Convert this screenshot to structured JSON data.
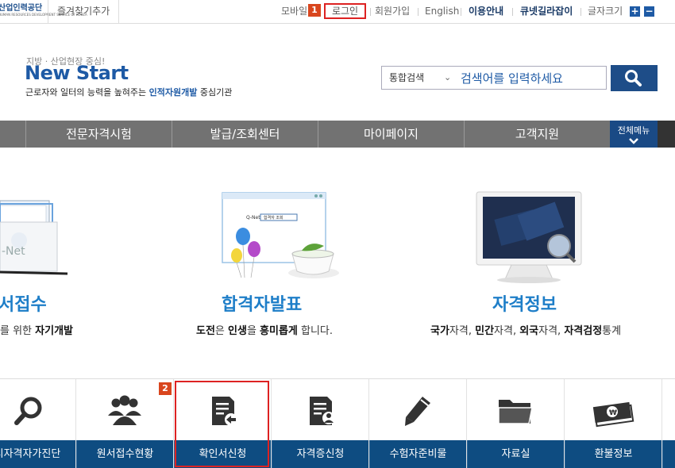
{
  "topbar": {
    "org_logo": "산업인력공단",
    "favorite": "즐겨찾기추가",
    "mobile": "모바일",
    "badge1": "1",
    "login": "로그인",
    "signup": "회원가입",
    "english": "English",
    "guide": "이용안내",
    "qnet_guide": "큐넷길라잡이",
    "font_size": "글자크기",
    "plus": "+",
    "minus": "−"
  },
  "header": {
    "tagline": "지방 · 산업현장 중심!",
    "brand": "New Start",
    "desc_pre": "근로자와 일터의 능력을 높혀주는 ",
    "desc_em": "인적자원개발",
    "desc_post": " 중심기관"
  },
  "search": {
    "category": "통합검색",
    "placeholder": "검색어를 입력하세요"
  },
  "nav": {
    "items": [
      "전문자격시험",
      "발급/조회센터",
      "마이페이지",
      "고객지원"
    ],
    "all_menu": "전체메뉴"
  },
  "features": [
    {
      "title": "서접수",
      "sub_pre": "를 위한 ",
      "sub_b": "자기개발",
      "sub_post": ""
    },
    {
      "title": "합격자발표"
    },
    {
      "title": "자격정보"
    }
  ],
  "feature2_sub": [
    {
      "t": "도전",
      "b": true
    },
    {
      "t": "은 ",
      "b": false
    },
    {
      "t": "인생",
      "b": true
    },
    {
      "t": "을 ",
      "b": false
    },
    {
      "t": "흥미롭게",
      "b": true
    },
    {
      "t": " 합니다.",
      "b": false
    }
  ],
  "feature3_sub": [
    {
      "t": "국가",
      "b": true
    },
    {
      "t": "자격, ",
      "b": false
    },
    {
      "t": "민간",
      "b": true
    },
    {
      "t": "자격, ",
      "b": false
    },
    {
      "t": "외국",
      "b": true
    },
    {
      "t": "자격, ",
      "b": false
    },
    {
      "t": "자격검정",
      "b": true
    },
    {
      "t": "통계",
      "b": false
    }
  ],
  "qnet_mock": {
    "brand": "Q-Net",
    "search_text": "합격자 조회"
  },
  "quick_menu": {
    "badge2": "2",
    "items": [
      "시자격자가진단",
      "원서접수현황",
      "확인서신청",
      "자격증신청",
      "수험자준비물",
      "자료실",
      "환불정보"
    ]
  },
  "colors": {
    "brand_blue": "#1e5aa5",
    "nav_gray": "#727272",
    "quick_navy": "#0e4c81",
    "highlight_red": "#dd2222",
    "badge_orange": "#d9461e"
  }
}
